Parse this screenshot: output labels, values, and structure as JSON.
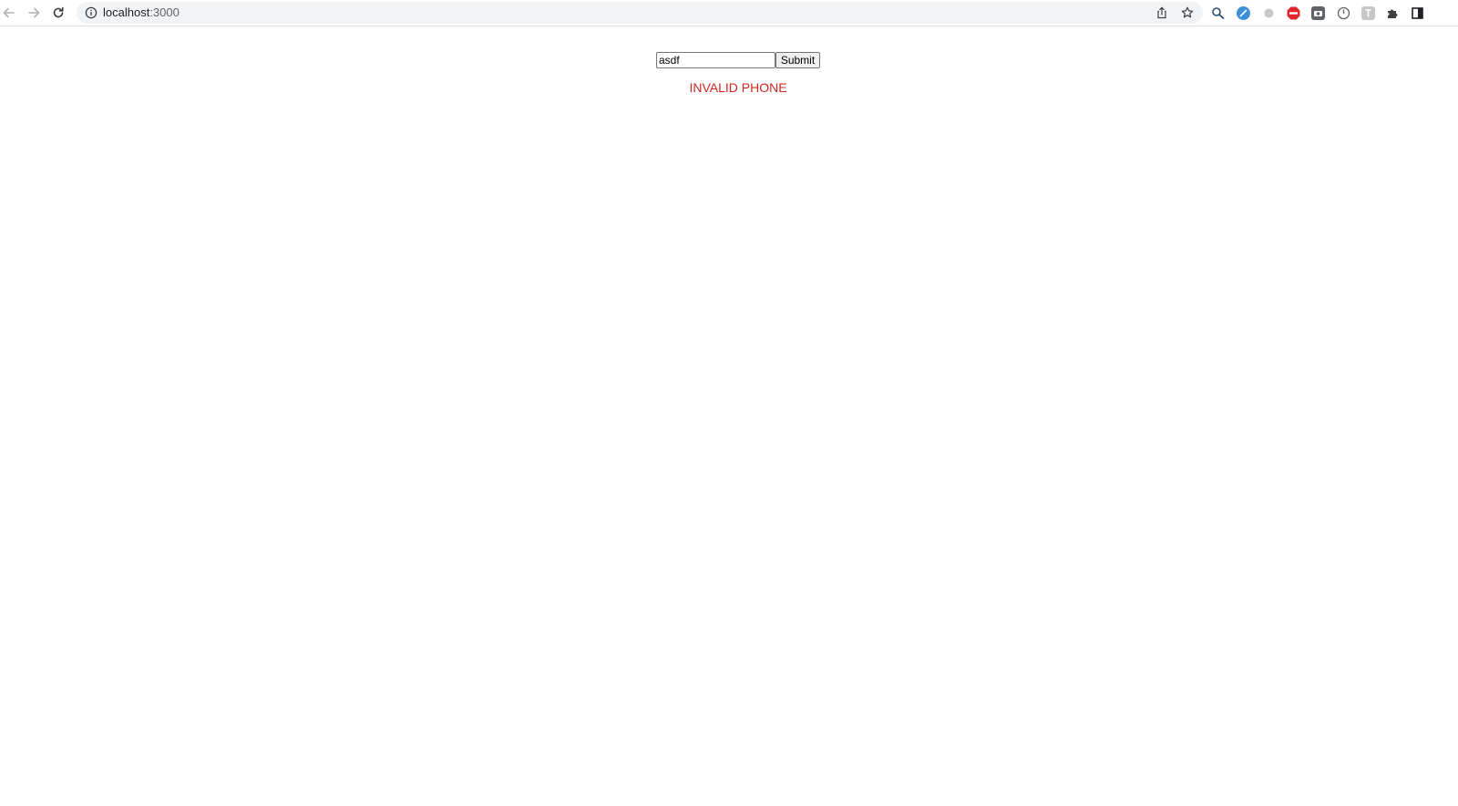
{
  "browser": {
    "url_host": "localhost",
    "url_port": ":3000",
    "toolbar_icons": [
      "back-icon",
      "forward-icon",
      "reload-icon",
      "site-info-icon",
      "share-icon",
      "bookmark-star-icon"
    ],
    "extensions": [
      "magnifier-extension-icon",
      "blue-extension-icon",
      "grey-dot-extension-icon",
      "adblock-extension-icon",
      "camera-extension-icon",
      "clock-extension-icon",
      "pin-extension-icon",
      "puzzle-extensions-icon",
      "side-panel-icon"
    ],
    "colors": {
      "adblock": "#e0262c",
      "ext_blue": "#3e8fd9"
    }
  },
  "form": {
    "phone_value": "asdf",
    "submit_label": "Submit"
  },
  "message": {
    "text": "INVALID PHONE",
    "color": "#d1261e"
  }
}
